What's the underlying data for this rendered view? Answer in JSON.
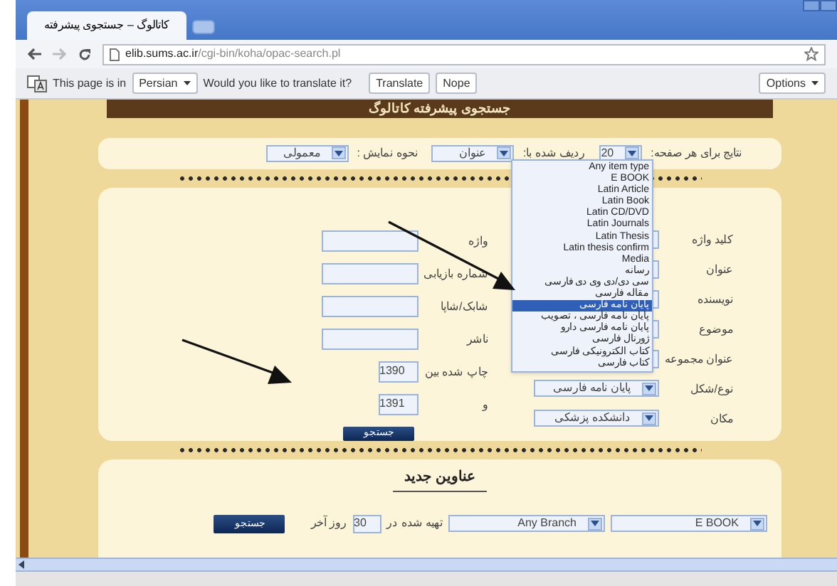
{
  "browser": {
    "tab_title": "کاتالوگ – جستجوی پیشرفته",
    "url_host": "elib.sums.ac.ir",
    "url_path": "/cgi-bin/koha/opac-search.pl"
  },
  "translate_bar": {
    "prefix": "This page is in",
    "language": "Persian",
    "question": "Would you like to translate it?",
    "translate_button": "Translate",
    "dismiss_button": "Nope",
    "options": "Options"
  },
  "banner": "جستجوی پیشرفته کاتالوگ",
  "sort_options": [
    {
      "label": "نتایج برای هر صفحه:",
      "value": "20"
    },
    {
      "label": "ردیف شده با:",
      "value": "عنوان"
    },
    {
      "label": "نحوه نمایش :",
      "value": "معمولی"
    }
  ],
  "search_fields": [
    {
      "label": "کلید واژه"
    },
    {
      "label": "عنوان"
    },
    {
      "label": "نویسنده"
    },
    {
      "label": "موضوع"
    },
    {
      "label": "عنوان مجموعه"
    }
  ],
  "selects": [
    {
      "label": "نوع/شکل",
      "value": "پایان نامه فارسی"
    },
    {
      "label": "مکان",
      "value": "دانشکده پزشکی"
    }
  ],
  "limits": [
    {
      "label": "واژه"
    },
    {
      "label": "شماره بازیابی"
    },
    {
      "label": "شابک/شاپا"
    },
    {
      "label": "ناشر"
    }
  ],
  "year_range": [
    {
      "label": "چاپ شده بین",
      "value": "1390"
    },
    {
      "label": "و",
      "value": "1391"
    }
  ],
  "search_button": "جستجو",
  "dropdown": [
    {
      "label": "Any item type",
      "selected": false
    },
    {
      "label": "E BOOK",
      "selected": false
    },
    {
      "label": "Latin Article",
      "selected": false
    },
    {
      "label": "Latin Book",
      "selected": false
    },
    {
      "label": "Latin CD/DVD",
      "selected": false
    },
    {
      "label": "Latin Journals",
      "selected": false
    },
    {
      "label": "Latin Thesis",
      "selected": false
    },
    {
      "label": "Latin thesis confirm",
      "selected": false
    },
    {
      "label": "Media",
      "selected": false
    },
    {
      "label": "رسانه",
      "selected": false
    },
    {
      "label": "سی دی/دی وی دی فارسی",
      "selected": false
    },
    {
      "label": "مقاله فارسی",
      "selected": false
    },
    {
      "label": "پایان نامه فارسی",
      "selected": true
    },
    {
      "label": "پایان نامه فارسی ، تصویب",
      "selected": false
    },
    {
      "label": "پایان نامه فارسی دارو",
      "selected": false
    },
    {
      "label": "ژورنال فارسی",
      "selected": false
    },
    {
      "label": "کتاب الکترونیکی فارسی",
      "selected": false
    },
    {
      "label": "کتاب فارسی",
      "selected": false
    }
  ],
  "new_titles": {
    "heading": "عناوین جدید",
    "item_type": "E BOOK",
    "branch": "Any Branch",
    "prefix": "تهیه شده در",
    "days": "30",
    "suffix": "روز آخر",
    "button": "جستجو"
  }
}
